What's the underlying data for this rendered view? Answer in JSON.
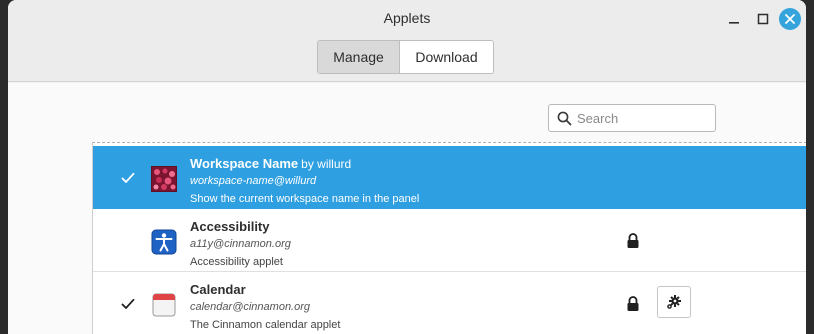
{
  "window": {
    "title": "Applets"
  },
  "tabs": [
    {
      "label": "Manage",
      "selected": true
    },
    {
      "label": "Download",
      "selected": false
    }
  ],
  "search": {
    "placeholder": "Search",
    "value": ""
  },
  "applets": [
    {
      "name": "Workspace Name",
      "author": "by willurd",
      "uuid": "workspace-name@willurd",
      "description": "Show the current workspace name in the panel",
      "enabled": true,
      "selected": true,
      "icon": "workspace-name-icon"
    },
    {
      "name": "Accessibility",
      "author": "",
      "uuid": "a11y@cinnamon.org",
      "description": "Accessibility applet",
      "enabled": false,
      "selected": false,
      "locked": true,
      "icon": "accessibility-icon"
    },
    {
      "name": "Calendar",
      "author": "",
      "uuid": "calendar@cinnamon.org",
      "description": "The Cinnamon calendar applet",
      "enabled": true,
      "selected": false,
      "locked": true,
      "configurable": true,
      "icon": "calendar-icon"
    }
  ],
  "colors": {
    "accent": "#2e9fe0",
    "close_button": "#35a4dc"
  }
}
